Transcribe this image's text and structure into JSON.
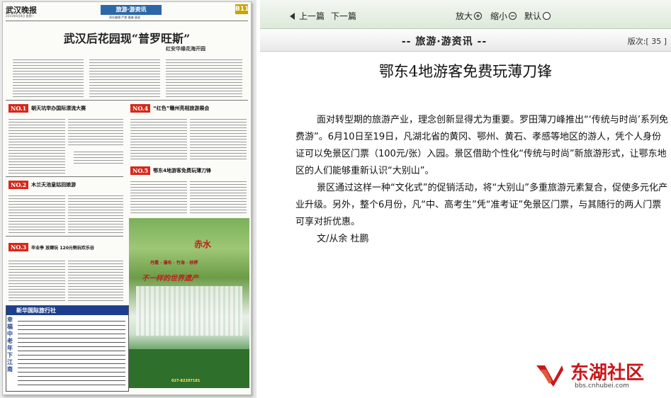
{
  "newspaper": {
    "masthead": "武汉晚报",
    "date_line": "2015年6月8日  星期一",
    "section_banner": "旅游·游资讯",
    "section_sub": "责任编辑  严睿  美编  唐波",
    "page_tag": "B11",
    "headline": "武汉后花园现“普罗旺斯”",
    "subhead": "红安华缘花海开园",
    "items": [
      {
        "no": "NO.1",
        "title": "朝天坑举办国际漂流大赛"
      },
      {
        "no": "NO.2",
        "title": "木兰天池皇姑回娘游"
      },
      {
        "no": "NO.3",
        "title": "毕业季 放肆玩  120元畅玩欢乐谷"
      },
      {
        "no": "NO.4",
        "title": "“红色”赣州亮相旅游展会"
      },
      {
        "no": "NO.5",
        "title": "鄂东4地游客免费玩薄刀锋"
      }
    ],
    "ad_travel_head": "新华国际旅行社",
    "ad_travel_side": "幸福中老年下江南",
    "ad_promo_logo": "赤水",
    "ad_promo_tagline": "丹霞 · 瀑布 · 竹海 · 桫椤",
    "ad_promo_slogan": "不一样的世界遗产",
    "ad_promo_phone": "027-82207181"
  },
  "toolbar": {
    "prev_label": "上一篇",
    "next_label": "下一篇",
    "zoom_in_label": "放大",
    "zoom_out_label": "缩小",
    "reset_label": "默认"
  },
  "section": {
    "title": "-- 旅游·游资讯 --",
    "edition_label": "版次:[ 35 ]"
  },
  "article": {
    "title": "鄂东4地游客免费玩薄刀锋",
    "paragraphs": [
      "面对转型期的旅游产业，理念创新显得尤为重要。罗田薄刀峰推出“‘传统与时尚’系列免费游”。6月10日至19日，凡湖北省的黄冈、鄂州、黄石、孝感等地区的游人，凭个人身份证可以免景区门票（100元/张）入园。景区借助个性化“传统与时尚”新旅游形式，让鄂东地区的人们能够重新认识“大别山”。",
      "景区通过这样一种“文化式”的促销活动，将“大别山”多重旅游元素复合，促使多元化产业升级。另外，整个6月份，凡“中、高考生”凭“准考证”免景区门票，与其随行的两人门票可享对折优惠。"
    ],
    "author": "文/从余 杜鹏"
  },
  "watermark": {
    "name": "东湖社区",
    "url": "bbs.cnhubei.com"
  },
  "colors": {
    "accent_red": "#d6281b",
    "banner_blue": "#2c67a7",
    "toolbar_green": "#dde9da"
  }
}
